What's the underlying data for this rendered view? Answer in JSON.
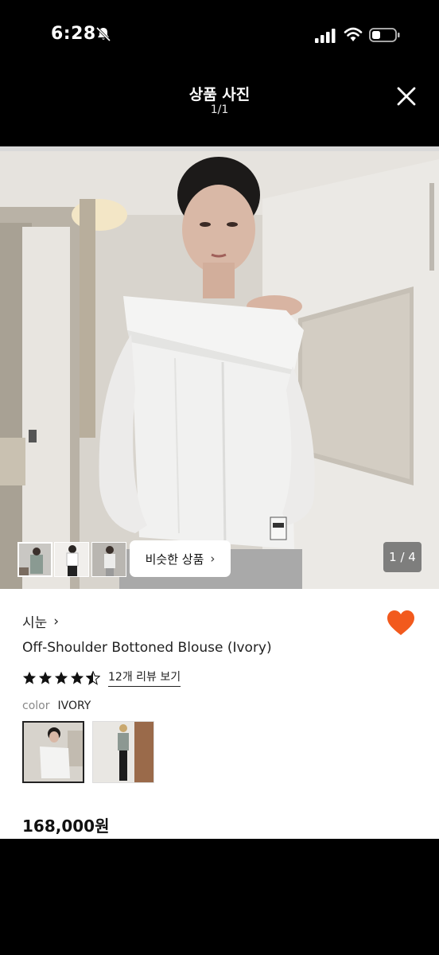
{
  "status_bar": {
    "time": "6:28",
    "icons": [
      "bell-slash-icon",
      "signal-icon",
      "wifi-icon",
      "battery-icon"
    ]
  },
  "viewer": {
    "title": "상품 사진",
    "counter": "1/1",
    "close_icon": "close-icon"
  },
  "product": {
    "photo_counter": "1 / 4",
    "similar_button_label": "비슷한 상품",
    "brand": "시눈",
    "name": "Off-Shoulder Bottoned Blouse (Ivory)",
    "rating": 4.5,
    "review_link": "12개 리뷰 보기",
    "color_label": "color",
    "color_value": "IVORY",
    "price": "168,000원",
    "liked": true
  },
  "colors": {
    "heart": "#f25a1d",
    "background": "#000000",
    "card": "#ffffff"
  }
}
